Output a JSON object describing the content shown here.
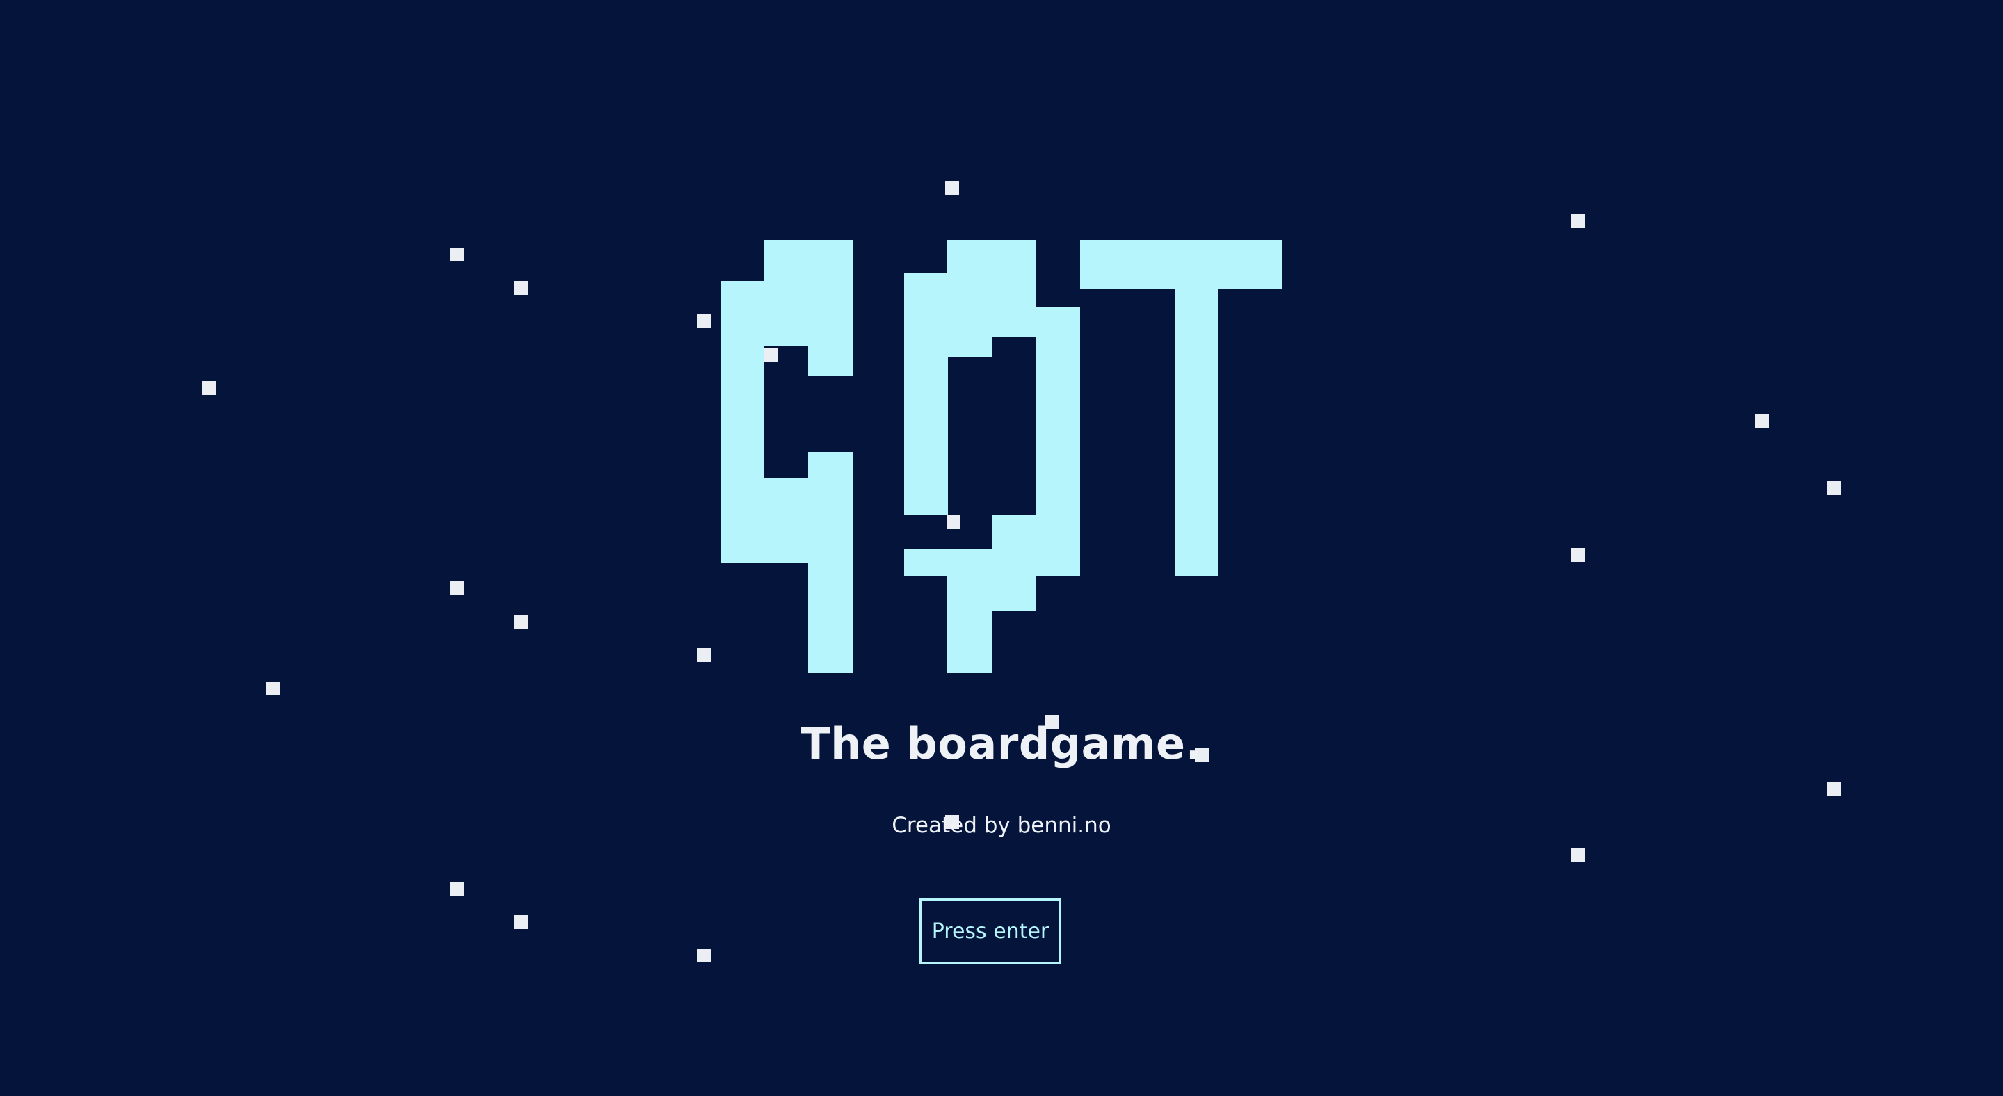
{
  "game": {
    "logo_text": "CQT",
    "tagline": "The boardgame.",
    "credit": "Created by benni.no",
    "start_prompt": "Press enter"
  },
  "colors": {
    "background": "#04143a",
    "logo": "#b6f5fc",
    "text": "#eef1f6",
    "particle": "#ebeef2"
  }
}
